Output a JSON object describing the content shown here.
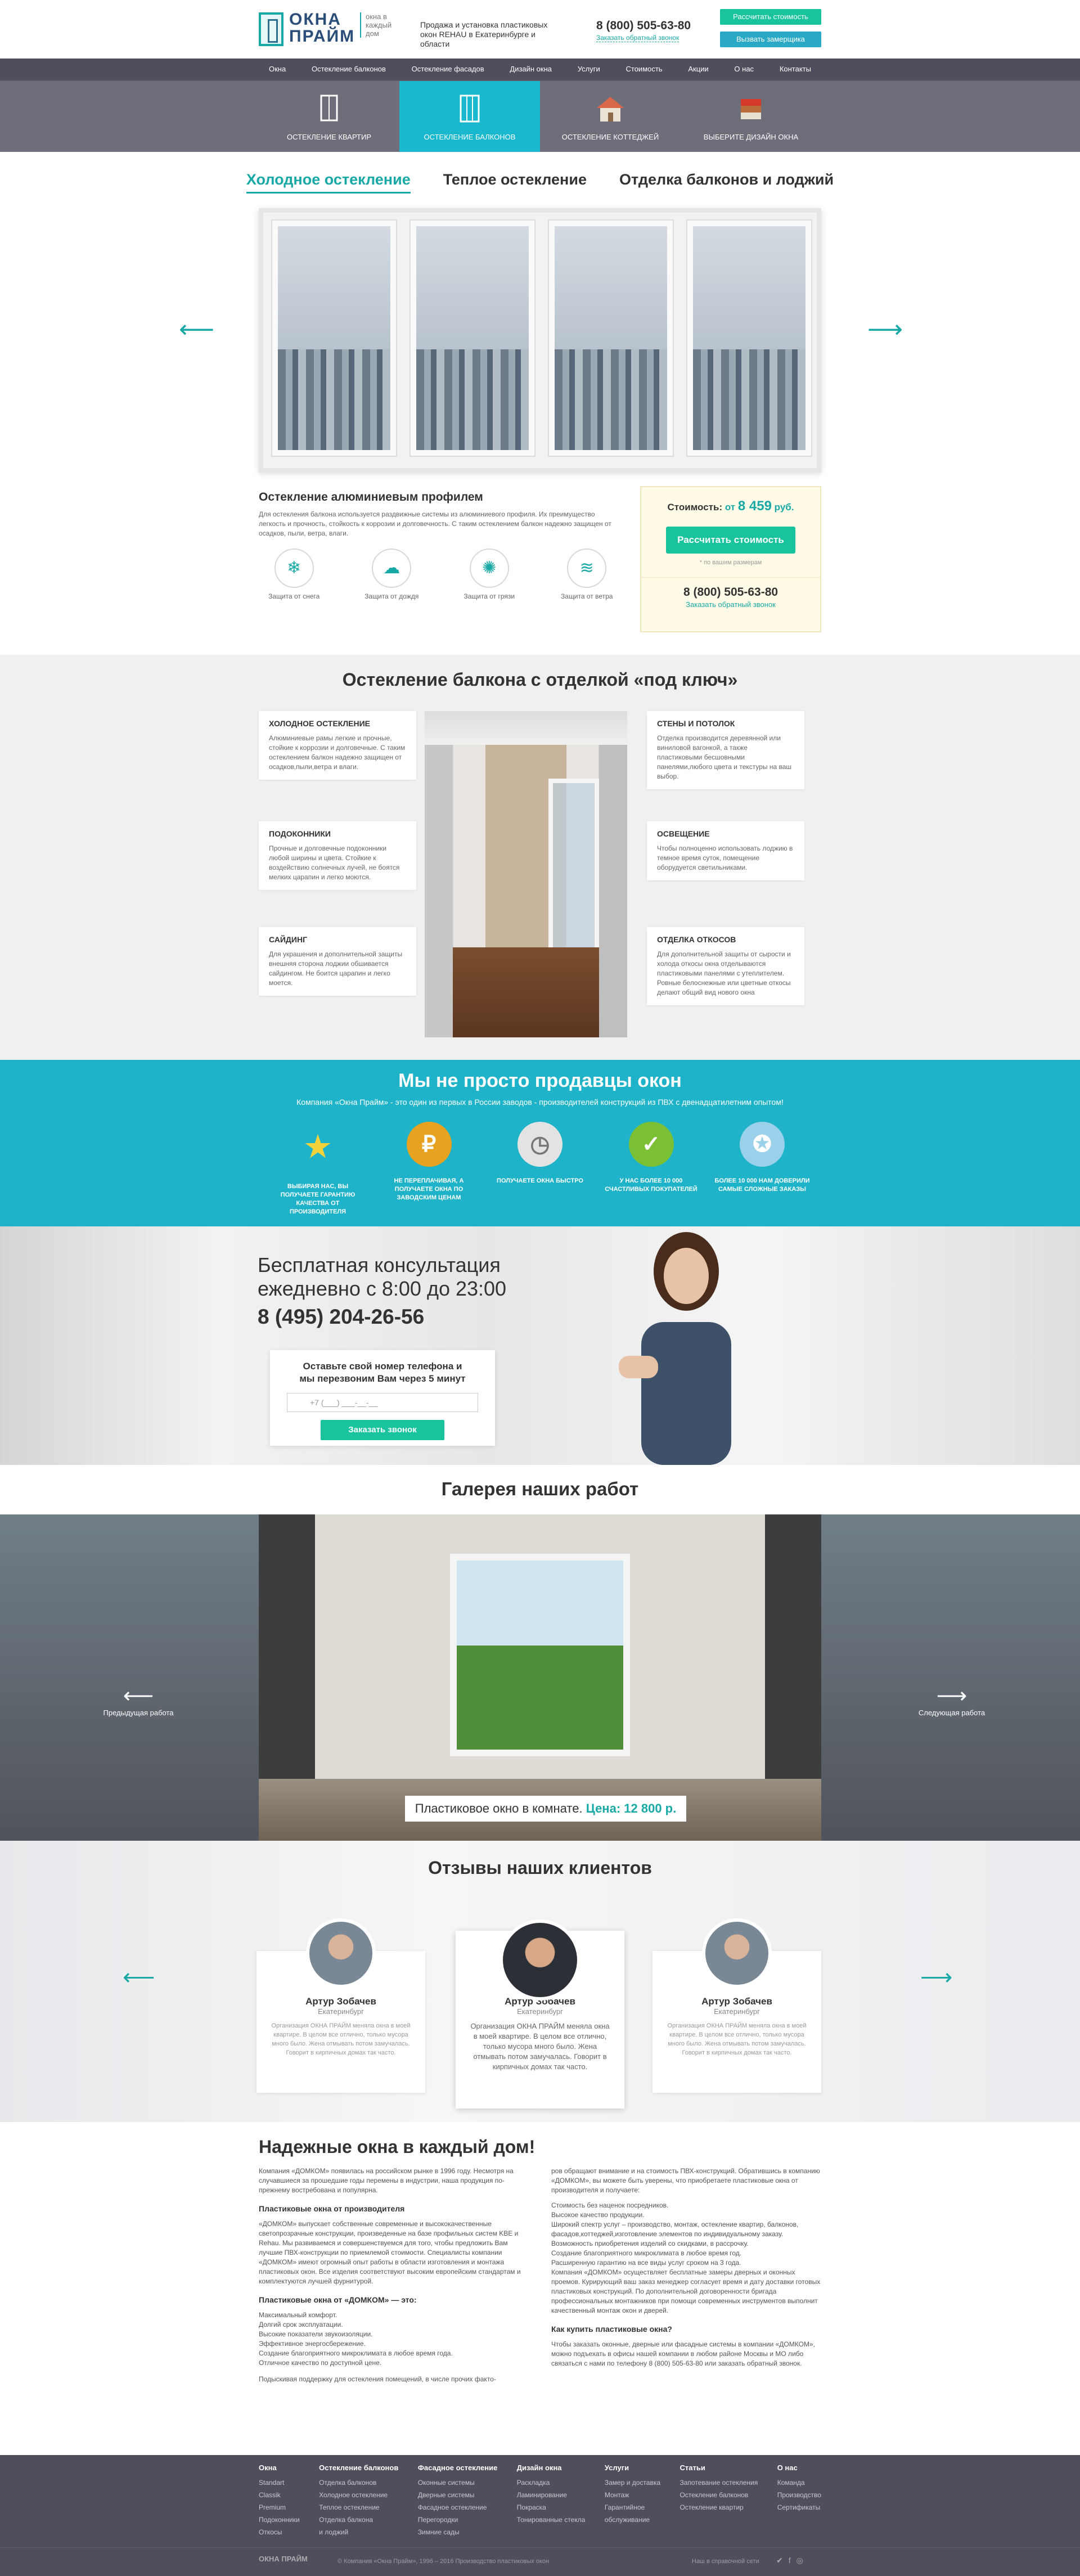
{
  "header": {
    "logo_name": "ОКНА ПРАЙМ",
    "logo_tagline": "окна в каждый дом",
    "description": "Продажа и установка пластиковых окон REHAU в Екатеринбурге и области",
    "phone": "8 (800) 505-63-80",
    "callback": "Заказать обратный звонок",
    "btn_calc": "Рассчитать стоимость",
    "btn_measure": "Вызвать замерщика"
  },
  "nav": [
    "Окна",
    "Остекление балконов",
    "Остекление фасадов",
    "Дизайн окна",
    "Услуги",
    "Стоимость",
    "Акции",
    "О нас",
    "Контакты"
  ],
  "categories": [
    "ОСТЕКЛЕНИЕ КВАРТИР",
    "ОСТЕКЛЕНИЕ БАЛКОНОВ",
    "ОСТЕКЛЕНИЕ КОТТЕДЖЕЙ",
    "ВЫБЕРИТЕ ДИЗАЙН ОКНА"
  ],
  "tabs": [
    "Холодное остекление",
    "Теплое остекление",
    "Отделка балконов и лоджий"
  ],
  "product": {
    "title": "Остекление алюминиевым профилем",
    "text": "Для остекления балкона используется раздвижные системы из алюминиевого профиля. Их преимущество легкость и прочность, стойкость к коррозии и долговечность. С таким остеклением балкон надежно защищен от осадков, пыли, ветра, влаги.",
    "features": [
      "Защита от снега",
      "Защита от дождя",
      "Защита от грязи",
      "Защита от ветра"
    ],
    "price_label": "Стоимость:",
    "price_prefix": "от",
    "price_value": "8 459",
    "price_unit": "руб.",
    "btn": "Рассчитать стоимость",
    "note": "* по вашим размерам",
    "phone": "8 (800) 505-63-80",
    "callback": "Заказать обратный звонок"
  },
  "balcony": {
    "title": "Остекление балкона с отделкой «под ключ»",
    "cards": [
      {
        "title": "ХОЛОДНОЕ ОСТЕКЛЕНИЕ",
        "text": "Алюминиевые рамы легкие и прочные, стойкие к коррозии и долговечные. С таким остеклением балкон надежно защищен от осадков,пыли,ветра и влаги."
      },
      {
        "title": "СТЕНЫ И ПОТОЛОК",
        "text": "Отделка производится деревянной или виниловой вагонкой, а также пластиковыми бесшовными панелями,любого цвета и текстуры на ваш выбор."
      },
      {
        "title": "ПОДОКОННИКИ",
        "text": "Прочные и долговечные подоконники любой ширины и цвета. Стойкие к воздействию солнечных лучей, не боятся мелких царапин и легко моются."
      },
      {
        "title": "ОСВЕЩЕНИЕ",
        "text": "Чтобы полноценно использовать лоджию в темное время суток, помещение оборудуется светильниками."
      },
      {
        "title": "САЙДИНГ",
        "text": "Для украшения и дополнительной защиты внешняя сторона лоджии обшивается сайдингом. Не боится царапин и легко моется."
      },
      {
        "title": "ОТДЕЛКА ОТКОСОВ",
        "text": "Для дополнительной защиты от сырости и холода откосы окна отделываются пластиковыми панелями с утеплителем. Ровные белоснежные или цветные откосы делают общий вид нового окна"
      }
    ]
  },
  "advantages": {
    "title": "Мы не просто продавцы окон",
    "subtitle": "Компания «Окна Прайм» - это один из первых в России заводов - производителей конструкций из ПВХ с двенадцатилетним опытом!",
    "items": [
      "ВЫБИРАЯ НАС, ВЫ ПОЛУЧАЕТЕ ГАРАНТИЮ КАЧЕСТВА ОТ ПРОИЗВОДИТЕЛЯ",
      "НЕ ПЕРЕПЛАЧИВАЯ, А ПОЛУЧАЕТЕ ОКНА ПО ЗАВОДСКИМ ЦЕНАМ",
      "ПОЛУЧАЕТЕ ОКНА БЫСТРО",
      "У НАС БОЛЕЕ 10 000 СЧАСТЛИВЫХ ПОКУПАТЕЛЕЙ",
      "БОЛЕЕ 10 000 НАМ ДОВЕРИЛИ САМЫЕ СЛОЖНЫЕ ЗАКАЗЫ"
    ]
  },
  "consult": {
    "title": "Бесплатная консультация ежедневно с 8:00 до 23:00",
    "phone": "8 (495) 204-26-56",
    "form_text": "Оставьте свой номер телефона и мы перезвоним Вам через 5 минут",
    "placeholder": "+7 (___) ___-__-__",
    "btn": "Заказать звонок"
  },
  "gallery": {
    "title": "Галерея наших работ",
    "prev": "Предыдущая работа",
    "next": "Следующая работа",
    "caption": "Пластиковое окно в комнате.",
    "price": "Цена: 12 800 р."
  },
  "reviews": {
    "title": "Отзывы наших клиентов",
    "items": [
      {
        "name": "Артур Зобачев",
        "city": "Екатеринбург",
        "text": "Организация ОКНА ПРАЙМ меняла окна в моей квартире. В целом все отлично, только мусора много было. Жена отмывать потом замучалась. Говорит в кирпичных домах так часто."
      },
      {
        "name": "Артур Зобачев",
        "city": "Екатеринбург",
        "text": "Организация ОКНА ПРАЙМ меняла окна в моей квартире. В целом все отлично, только мусора много было. Жена отмывать потом замучалась. Говорит в кирпичных домах так часто."
      },
      {
        "name": "Артур Зобачев",
        "city": "Екатеринбург",
        "text": "Организация ОКНА ПРАЙМ меняла окна в моей квартире. В целом все отлично, только мусора много было. Жена отмывать потом замучалась. Говорит в кирпичных домах так часто."
      }
    ]
  },
  "about": {
    "title": "Надежные окна в каждый дом!",
    "p1": "Компания «ДОМКОМ» появилась на российском рынке в 1996 году. Несмотря на случавшиеся за прошедшие годы перемены в индустрии, наша продукция по-прежнему востребована и популярна.",
    "h1": "Пластиковые окна от производителя",
    "p2": "«ДОМКОМ» выпускает собственные современные и высококачественные светопрозрачные конструкции, произведенные на базе профильных систем KBE и Rehau. Мы развиваемся и совершенствуемся для того, чтобы предложить Вам лучшие ПВХ-конструкции по приемлемой стоимости. Специалисты компании «ДОМКОМ» имеют огромный опыт работы в области изготовления и монтажа пластиковых окон. Все изделия соответствуют высоким европейским стандартам и комплектуются лучшей фурнитурой.",
    "h2": "Пластиковые окна от «ДОМКОМ» — это:",
    "list": [
      "Максимальный комфорт.",
      "Долгий срок эксплуатации.",
      "Высокие показатели звукоизоляции.",
      "Эффективное энергосбережение.",
      "Создание благоприятного микроклимата в любое время года.",
      "Отличное качество по доступной цене."
    ],
    "p3": "Подыскивая поддержку для остекления помещений, в числе прочих факто-",
    "p4": "ров обращают внимание и на стоимость ПВХ-конструкций. Обратившись в компанию «ДОМКОМ», вы можете быть уверены, что приобретаете пластиковые окна от производителя и получаете:",
    "list2": [
      "Стоимость без наценок посредников.",
      "Высокое качество продукции.",
      "Широкий спектр услуг – производство, монтаж, остекление квартир, балконов, фасадов,коттеджей,изготовление элементов по индивидуальному заказу.",
      "Возможность приобретения изделий со скидками, в рассрочку.",
      "Создание благоприятного микроклимата в любое время год.",
      "Расширенную гарантию на все виды услуг сроком на 3 года.",
      "Компания «ДОМКОМ» осуществляет бесплатные замеры дверных и оконных проемов. Курирующий ваш заказ менеджер согласует время и дату доставки готовых пластиковых конструкций. По дополнительной договоренности бригада профессиональных монтажников при помощи современных инструментов выполнит качественный монтаж окон и дверей."
    ],
    "h3": "Как купить пластиковые окна?",
    "p5": "Чтобы заказать оконные, дверные или фасадные системы в компании «ДОМКОМ», можно подъехать в офисы нашей компании в любом районе Москвы и МО либо связаться с нами по телефону 8 (800) 505-63-80 или заказать обратный звонок."
  },
  "footer": {
    "columns": [
      {
        "title": "Окна",
        "items": [
          "Standart",
          "Classik",
          "Premium",
          "Подоконники",
          "Откосы"
        ]
      },
      {
        "title": "Остекление балконов",
        "items": [
          "Отделка балконов",
          "Холодное остекление",
          "Теплое остекление",
          "Отделка балкона",
          "и лоджий"
        ]
      },
      {
        "title": "Фасадное остекление",
        "items": [
          "Оконные системы",
          "Дверные системы",
          "Фасадное остекление",
          "Перегородки",
          "Зимние сады"
        ]
      },
      {
        "title": "Дизайн окна",
        "items": [
          "Раскладка",
          "Ламинирование",
          "Покраска",
          "Тонированные стекла"
        ]
      },
      {
        "title": "Услуги",
        "items": [
          "Замер и доставка",
          "Монтаж",
          "Гарантийное",
          "обслуживание"
        ]
      },
      {
        "title": "Статьи",
        "items": [
          "Запотевание остекления",
          "Остекление балконов",
          "Остекление квартир"
        ]
      },
      {
        "title": "О нас",
        "items": [
          "Команда",
          "Производство",
          "Сертификаты"
        ]
      }
    ],
    "copyright": "© Компания «Окна Прайм», 1996 – 2016 Производство пластиковых окон",
    "dev": "Наш в справочной сети"
  }
}
